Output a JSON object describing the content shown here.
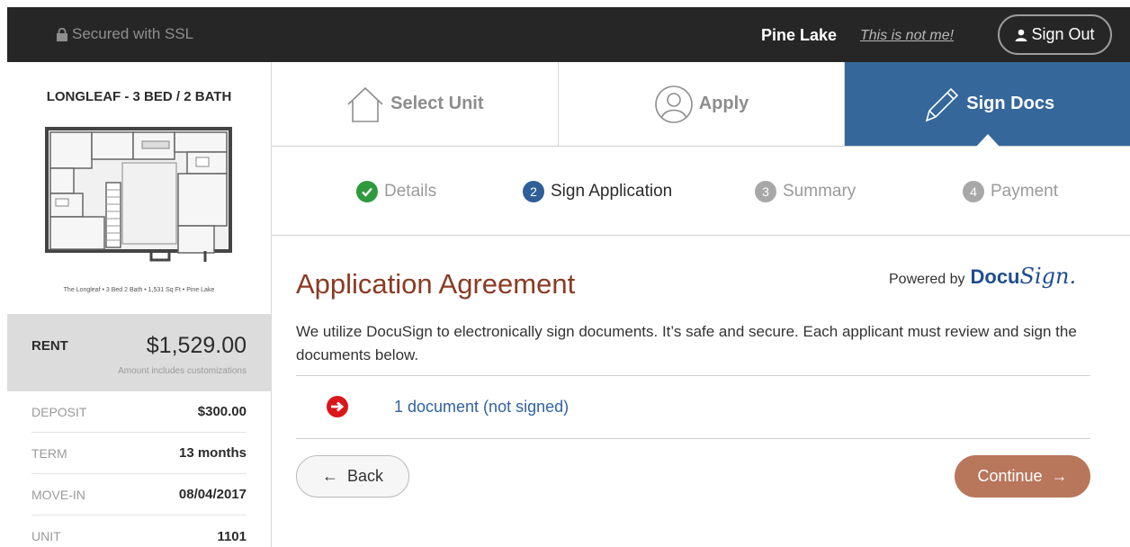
{
  "header": {
    "ssl_label": "Secured with SSL",
    "user_name": "Pine Lake",
    "not_me_link": "This is not me!",
    "sign_out_label": "Sign Out"
  },
  "sidebar": {
    "unit_title": "LONGLEAF - 3 BED / 2 BATH",
    "floorplan_caption": "The Longleaf • 3 Bed 2 Bath • 1,531 Sq Ft • Pine Lake",
    "rent": {
      "label": "RENT",
      "value": "$1,529.00",
      "note": "Amount includes customizations"
    },
    "details": [
      {
        "label": "DEPOSIT",
        "value": "$300.00"
      },
      {
        "label": "TERM",
        "value": "13 months"
      },
      {
        "label": "MOVE-IN",
        "value": "08/04/2017"
      },
      {
        "label": "UNIT",
        "value": "1101"
      }
    ]
  },
  "steps": [
    {
      "label": "Select Unit",
      "icon": "house-icon",
      "active": false
    },
    {
      "label": "Apply",
      "icon": "person-icon",
      "active": false
    },
    {
      "label": "Sign Docs",
      "icon": "pencil-icon",
      "active": true
    }
  ],
  "substeps": [
    {
      "badge": "",
      "label": "Details",
      "status": "done"
    },
    {
      "badge": "2",
      "label": "Sign Application",
      "status": "current"
    },
    {
      "badge": "3",
      "label": "Summary",
      "status": "upcoming"
    },
    {
      "badge": "4",
      "label": "Payment",
      "status": "upcoming"
    }
  ],
  "content": {
    "title": "Application Agreement",
    "powered_by": "Powered by",
    "docusign_logo_part1": "Docu",
    "docusign_logo_part2": "Sign.",
    "intro": "We utilize DocuSign to electronically sign documents. It’s safe and secure. Each applicant must review and sign the documents below.",
    "document_link": "1 document (not signed)",
    "back_label": "Back",
    "continue_label": "Continue"
  },
  "colors": {
    "topbar": "#262626",
    "active_step": "#35679a",
    "title": "#8b3a23",
    "continue_button": "#b8765b",
    "link": "#2f62a1",
    "done_check": "#2f9a3d",
    "alert_red": "#d9161b"
  }
}
